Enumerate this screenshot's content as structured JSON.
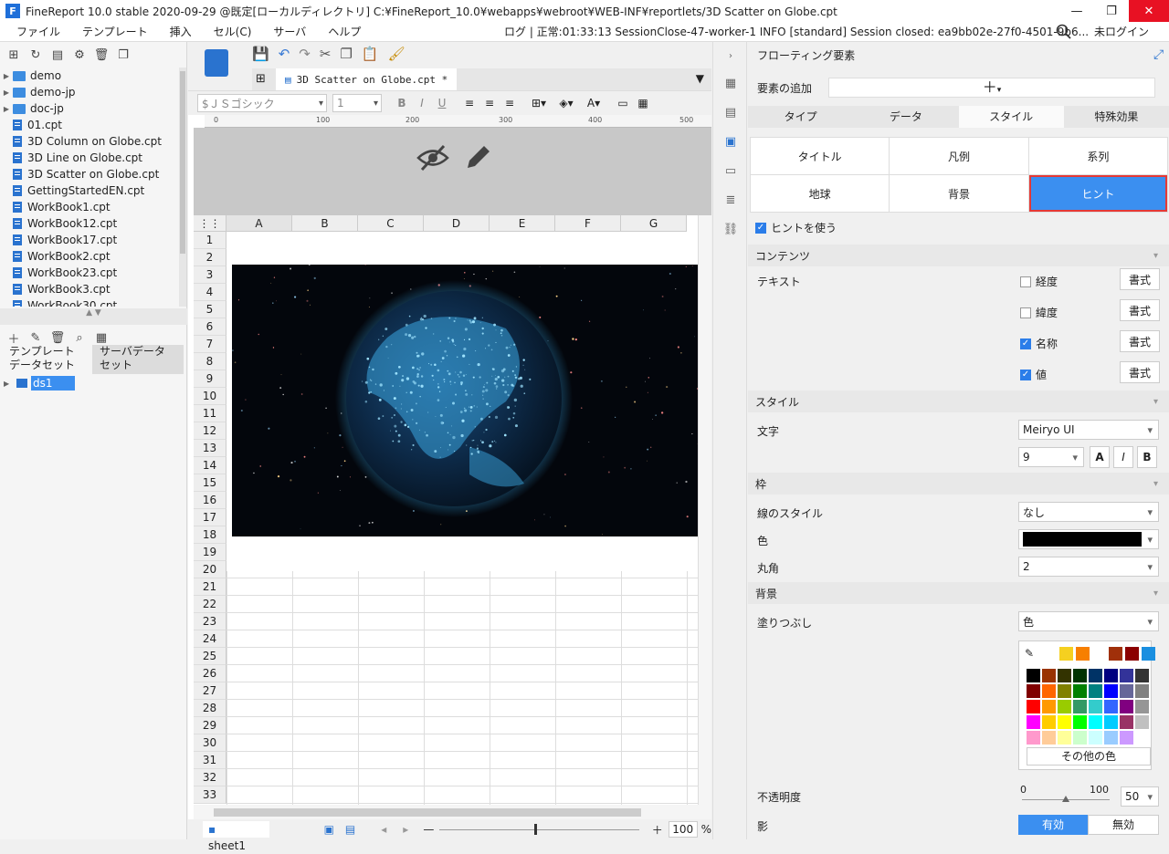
{
  "window": {
    "title": "FineReport 10.0 stable 2020-09-29 @既定[ローカルディレクトリ]   C:¥FineReport_10.0¥webapps¥webroot¥WEB-INF¥reportlets/3D Scatter on Globe.cpt",
    "logo": "F"
  },
  "menu": {
    "items": [
      "ファイル",
      "テンプレート",
      "挿入",
      "セル(C)",
      "サーバ",
      "ヘルプ"
    ],
    "status": "ログ | 正常:01:33:13 SessionClose-47-worker-1 INFO [standard] Session closed: ea9bb02e-27f0-4501-9b6...",
    "login": "未ログイン"
  },
  "left": {
    "tree": [
      {
        "type": "folder",
        "label": "demo"
      },
      {
        "type": "folder",
        "label": "demo-jp"
      },
      {
        "type": "folder",
        "label": "doc-jp"
      },
      {
        "type": "file",
        "label": "01.cpt"
      },
      {
        "type": "file",
        "label": "3D Column on Globe.cpt"
      },
      {
        "type": "file",
        "label": "3D Line on Globe.cpt"
      },
      {
        "type": "file",
        "label": "3D Scatter on Globe.cpt"
      },
      {
        "type": "file",
        "label": "GettingStartedEN.cpt"
      },
      {
        "type": "file",
        "label": "WorkBook1.cpt"
      },
      {
        "type": "file",
        "label": "WorkBook12.cpt"
      },
      {
        "type": "file",
        "label": "WorkBook17.cpt"
      },
      {
        "type": "file",
        "label": "WorkBook2.cpt"
      },
      {
        "type": "file",
        "label": "WorkBook23.cpt"
      },
      {
        "type": "file",
        "label": "WorkBook3.cpt"
      },
      {
        "type": "file",
        "label": "WorkBook30.cpt"
      }
    ],
    "tab_template": "テンプレート\nデータセット",
    "tab_server": "サーバデータ\nセット",
    "dataset": "ds1"
  },
  "editor": {
    "file_tab": "3D Scatter on Globe.cpt *",
    "font": "$ＪＳゴシック",
    "size": "1",
    "ruler": [
      "0",
      "100",
      "200",
      "300",
      "400",
      "500"
    ],
    "columns": [
      "A",
      "B",
      "C",
      "D",
      "E",
      "F",
      "G"
    ],
    "rows": [
      "1",
      "2",
      "3",
      "4",
      "5",
      "6",
      "7",
      "8",
      "9",
      "10",
      "11",
      "12",
      "13",
      "14",
      "15",
      "16",
      "17",
      "18",
      "19",
      "20",
      "21",
      "22",
      "23",
      "24",
      "25",
      "26",
      "27",
      "28",
      "29",
      "30",
      "31",
      "32",
      "33"
    ],
    "sheet": "sheet1",
    "zoom": "100",
    "zoom_unit": "%"
  },
  "panel": {
    "header": "フローティング要素",
    "add_label": "要素の追加",
    "tabs": [
      "タイプ",
      "データ",
      "スタイル",
      "特殊効果"
    ],
    "active_tab": "スタイル",
    "style_buttons": [
      "タイトル",
      "凡例",
      "系列",
      "地球",
      "背景",
      "ヒント"
    ],
    "use_hint": "ヒントを使う",
    "sec_contents": "コンテンツ",
    "text_label": "テキスト",
    "checks": [
      {
        "label": "経度",
        "checked": false
      },
      {
        "label": "緯度",
        "checked": false
      },
      {
        "label": "名称",
        "checked": true
      },
      {
        "label": "値",
        "checked": true
      }
    ],
    "format_btn": "書式",
    "sec_style": "スタイル",
    "char_label": "文字",
    "font_value": "Meiryo UI",
    "font_size": "9",
    "bold": "A",
    "italic": "I",
    "bold2": "B",
    "sec_frame": "枠",
    "line_style_label": "線のスタイル",
    "line_style_value": "なし",
    "color_label": "色",
    "color_value": "#000000",
    "radius_label": "丸角",
    "radius_value": "2",
    "sec_bg": "背景",
    "fill_label": "塗りつぶし",
    "fill_value": "色",
    "more_colors": "その他の色",
    "opacity_label": "不透明度",
    "opacity_min": "0",
    "opacity_max": "100",
    "opacity_value": "50",
    "shadow_label": "影",
    "shadow_on": "有効",
    "shadow_off": "無効"
  }
}
